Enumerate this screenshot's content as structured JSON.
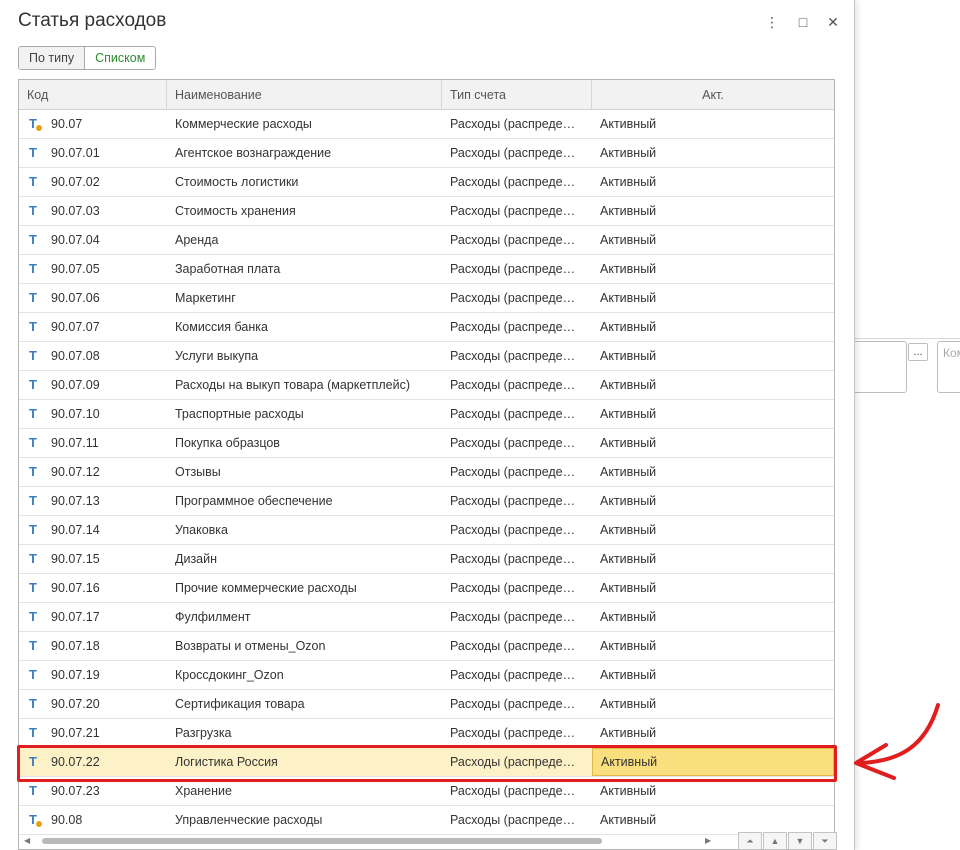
{
  "window": {
    "title": "Статья расходов"
  },
  "view_toggle": {
    "by_type": "По типу",
    "list": "Списком"
  },
  "columns": {
    "code": "Код",
    "name": "Наименование",
    "type": "Тип счета",
    "act": "Акт."
  },
  "rows": [
    {
      "code": "90.07",
      "name": "Коммерческие расходы",
      "type": "Расходы (распреде…",
      "act": "Активный",
      "group": true
    },
    {
      "code": "90.07.01",
      "name": "Агентское вознаграждение",
      "type": "Расходы (распреде…",
      "act": "Активный"
    },
    {
      "code": "90.07.02",
      "name": "Стоимость логистики",
      "type": "Расходы (распреде…",
      "act": "Активный"
    },
    {
      "code": "90.07.03",
      "name": "Стоимость хранения",
      "type": "Расходы (распреде…",
      "act": "Активный"
    },
    {
      "code": "90.07.04",
      "name": "Аренда",
      "type": "Расходы (распреде…",
      "act": "Активный"
    },
    {
      "code": "90.07.05",
      "name": "Заработная плата",
      "type": "Расходы (распреде…",
      "act": "Активный"
    },
    {
      "code": "90.07.06",
      "name": "Маркетинг",
      "type": "Расходы (распреде…",
      "act": "Активный"
    },
    {
      "code": "90.07.07",
      "name": "Комиссия банка",
      "type": "Расходы (распреде…",
      "act": "Активный"
    },
    {
      "code": "90.07.08",
      "name": "Услуги выкупа",
      "type": "Расходы (распреде…",
      "act": "Активный"
    },
    {
      "code": "90.07.09",
      "name": "Расходы на выкуп товара (маркетплейс)",
      "type": "Расходы (распреде…",
      "act": "Активный"
    },
    {
      "code": "90.07.10",
      "name": "Траспортные расходы",
      "type": "Расходы (распреде…",
      "act": "Активный"
    },
    {
      "code": "90.07.11",
      "name": "Покупка образцов",
      "type": "Расходы (распреде…",
      "act": "Активный"
    },
    {
      "code": "90.07.12",
      "name": "Отзывы",
      "type": "Расходы (распреде…",
      "act": "Активный"
    },
    {
      "code": "90.07.13",
      "name": "Программное обеспечение",
      "type": "Расходы (распреде…",
      "act": "Активный"
    },
    {
      "code": "90.07.14",
      "name": "Упаковка",
      "type": "Расходы (распреде…",
      "act": "Активный"
    },
    {
      "code": "90.07.15",
      "name": "Дизайн",
      "type": "Расходы (распреде…",
      "act": "Активный"
    },
    {
      "code": "90.07.16",
      "name": "Прочие коммерческие расходы",
      "type": "Расходы (распреде…",
      "act": "Активный"
    },
    {
      "code": "90.07.17",
      "name": "Фулфилмент",
      "type": "Расходы (распреде…",
      "act": "Активный"
    },
    {
      "code": "90.07.18",
      "name": "Возвраты и отмены_Ozon",
      "type": "Расходы (распреде…",
      "act": "Активный"
    },
    {
      "code": "90.07.19",
      "name": "Кроссдокинг_Ozon",
      "type": "Расходы (распреде…",
      "act": "Активный"
    },
    {
      "code": "90.07.20",
      "name": "Сертификация товара",
      "type": "Расходы (распреде…",
      "act": "Активный"
    },
    {
      "code": "90.07.21",
      "name": "Разгрузка",
      "type": "Расходы (распреде…",
      "act": "Активный"
    },
    {
      "code": "90.07.22",
      "name": "Логистика Россия",
      "type": "Расходы (распреде…",
      "act": "Активный",
      "selected": true
    },
    {
      "code": "90.07.23",
      "name": "Хранение",
      "type": "Расходы (распреде…",
      "act": "Активный"
    },
    {
      "code": "90.08",
      "name": "Управленческие расходы",
      "type": "Расходы (распреде…",
      "act": "Активный",
      "group": true
    }
  ],
  "background": {
    "field_placeholder": "Ком",
    "dots": "..."
  },
  "icons": {
    "row": "T",
    "close": "✕",
    "maximize": "□",
    "more": "⋮"
  },
  "colors": {
    "selected_row": "#fdf2c7",
    "selected_cell": "#f9df7e",
    "annotation": "#e11d1d"
  }
}
